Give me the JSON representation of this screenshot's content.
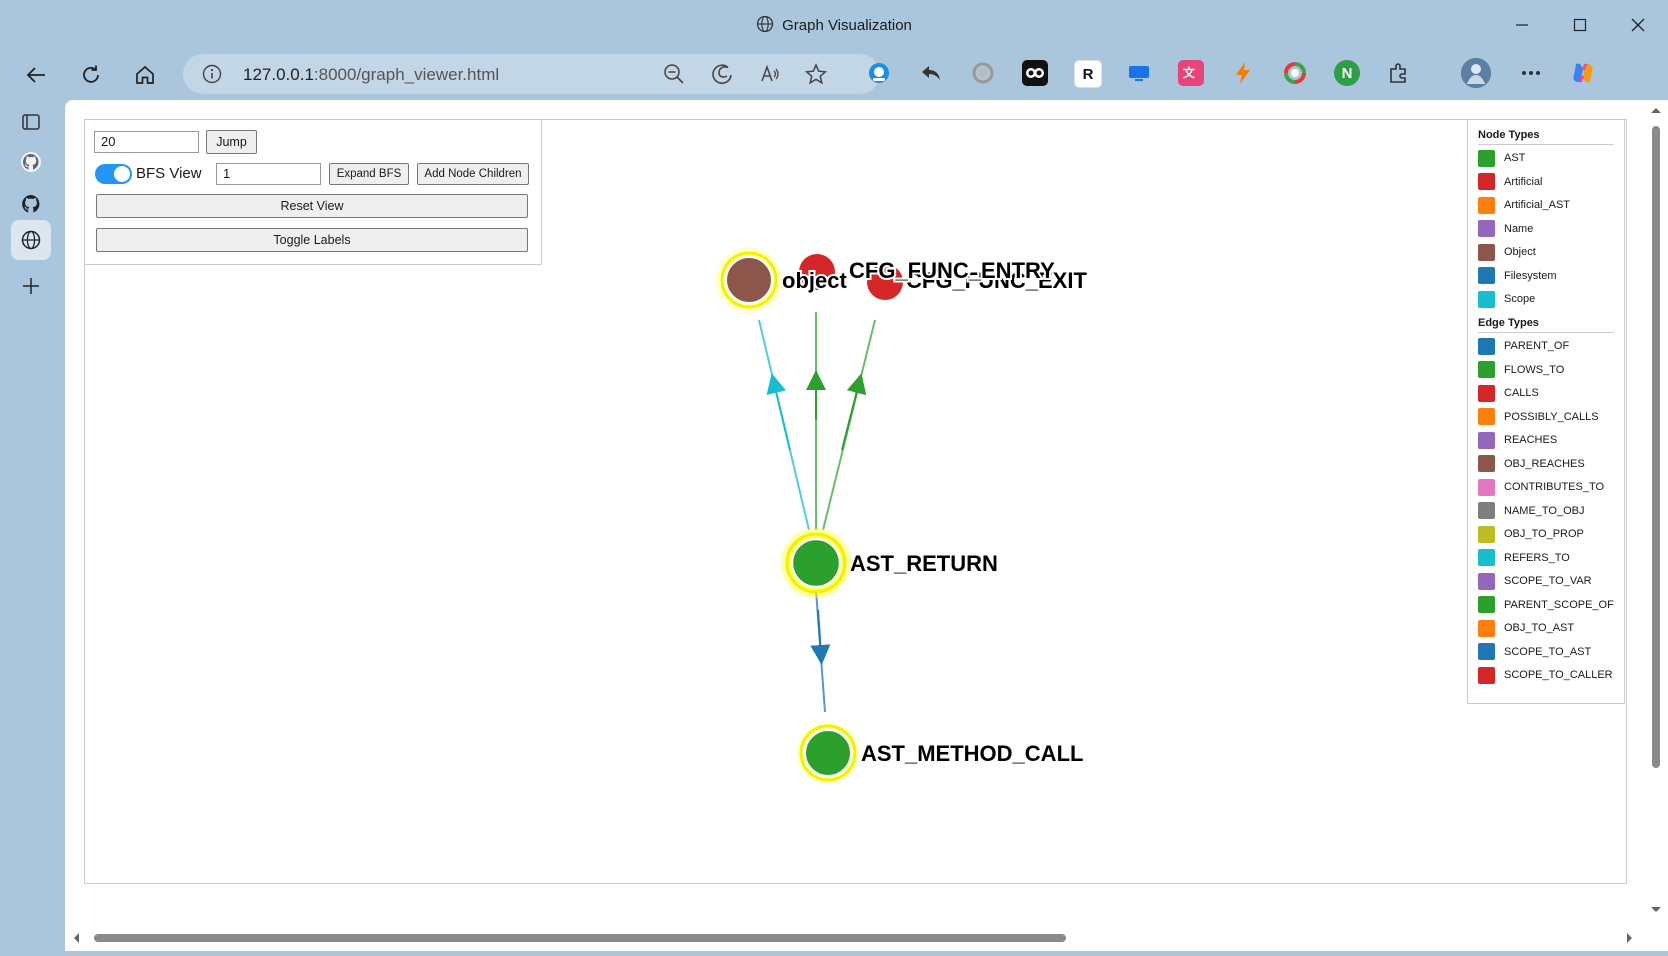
{
  "window": {
    "title": "Graph Visualization"
  },
  "browser": {
    "url_host": "127.0.0.1",
    "url_rest": ":8000/graph_viewer.html"
  },
  "controls": {
    "jump_value": "20",
    "jump_label": "Jump",
    "bfs_toggle_on": true,
    "bfs_label": "BFS View",
    "bfs_depth_value": "1",
    "expand_bfs_label": "Expand BFS",
    "add_children_label": "Add Node Children",
    "reset_label": "Reset View",
    "toggle_labels_label": "Toggle Labels"
  },
  "legend": {
    "node_types_title": "Node Types",
    "node_types": [
      {
        "label": "AST",
        "color": "#2ca02c"
      },
      {
        "label": "Artificial",
        "color": "#d62728"
      },
      {
        "label": "Artificial_AST",
        "color": "#ff7f0e"
      },
      {
        "label": "Name",
        "color": "#9467bd"
      },
      {
        "label": "Object",
        "color": "#8c564b"
      },
      {
        "label": "Filesystem",
        "color": "#1f77b4"
      },
      {
        "label": "Scope",
        "color": "#17becf"
      }
    ],
    "edge_types_title": "Edge Types",
    "edge_types": [
      {
        "label": "PARENT_OF",
        "color": "#1f77b4"
      },
      {
        "label": "FLOWS_TO",
        "color": "#2ca02c"
      },
      {
        "label": "CALLS",
        "color": "#d62728"
      },
      {
        "label": "POSSIBLY_CALLS",
        "color": "#ff7f0e"
      },
      {
        "label": "REACHES",
        "color": "#9467bd"
      },
      {
        "label": "OBJ_REACHES",
        "color": "#8c564b"
      },
      {
        "label": "CONTRIBUTES_TO",
        "color": "#e377c2"
      },
      {
        "label": "NAME_TO_OBJ",
        "color": "#7f7f7f"
      },
      {
        "label": "OBJ_TO_PROP",
        "color": "#bcbd22"
      },
      {
        "label": "REFERS_TO",
        "color": "#17becf"
      },
      {
        "label": "SCOPE_TO_VAR",
        "color": "#9467bd"
      },
      {
        "label": "PARENT_SCOPE_OF",
        "color": "#2ca02c"
      },
      {
        "label": "OBJ_TO_AST",
        "color": "#ff7f0e"
      },
      {
        "label": "SCOPE_TO_AST",
        "color": "#1f77b4"
      },
      {
        "label": "SCOPE_TO_CALLER",
        "color": "#d62728"
      }
    ]
  },
  "graph": {
    "nodes": [
      {
        "id": "object",
        "label": "object",
        "type": "Object",
        "highlighted": true
      },
      {
        "id": "cfg_entry",
        "label": "CFG_FUNC_ENTRY",
        "type": "Artificial",
        "highlighted": false
      },
      {
        "id": "cfg_exit",
        "label": "CFG_FUNC_EXIT",
        "type": "Artificial",
        "highlighted": false
      },
      {
        "id": "ast_return",
        "label": "AST_RETURN",
        "type": "AST",
        "highlighted": true,
        "selected": true
      },
      {
        "id": "ast_method_call",
        "label": "AST_METHOD_CALL",
        "type": "AST",
        "highlighted": true
      }
    ],
    "edges": [
      {
        "from": "ast_return",
        "to": "object",
        "type": "REFERS_TO"
      },
      {
        "from": "ast_return",
        "to": "cfg_entry",
        "type": "FLOWS_TO"
      },
      {
        "from": "ast_return",
        "to": "cfg_exit",
        "type": "FLOWS_TO"
      },
      {
        "from": "ast_return",
        "to": "ast_method_call",
        "type": "PARENT_OF"
      }
    ]
  }
}
